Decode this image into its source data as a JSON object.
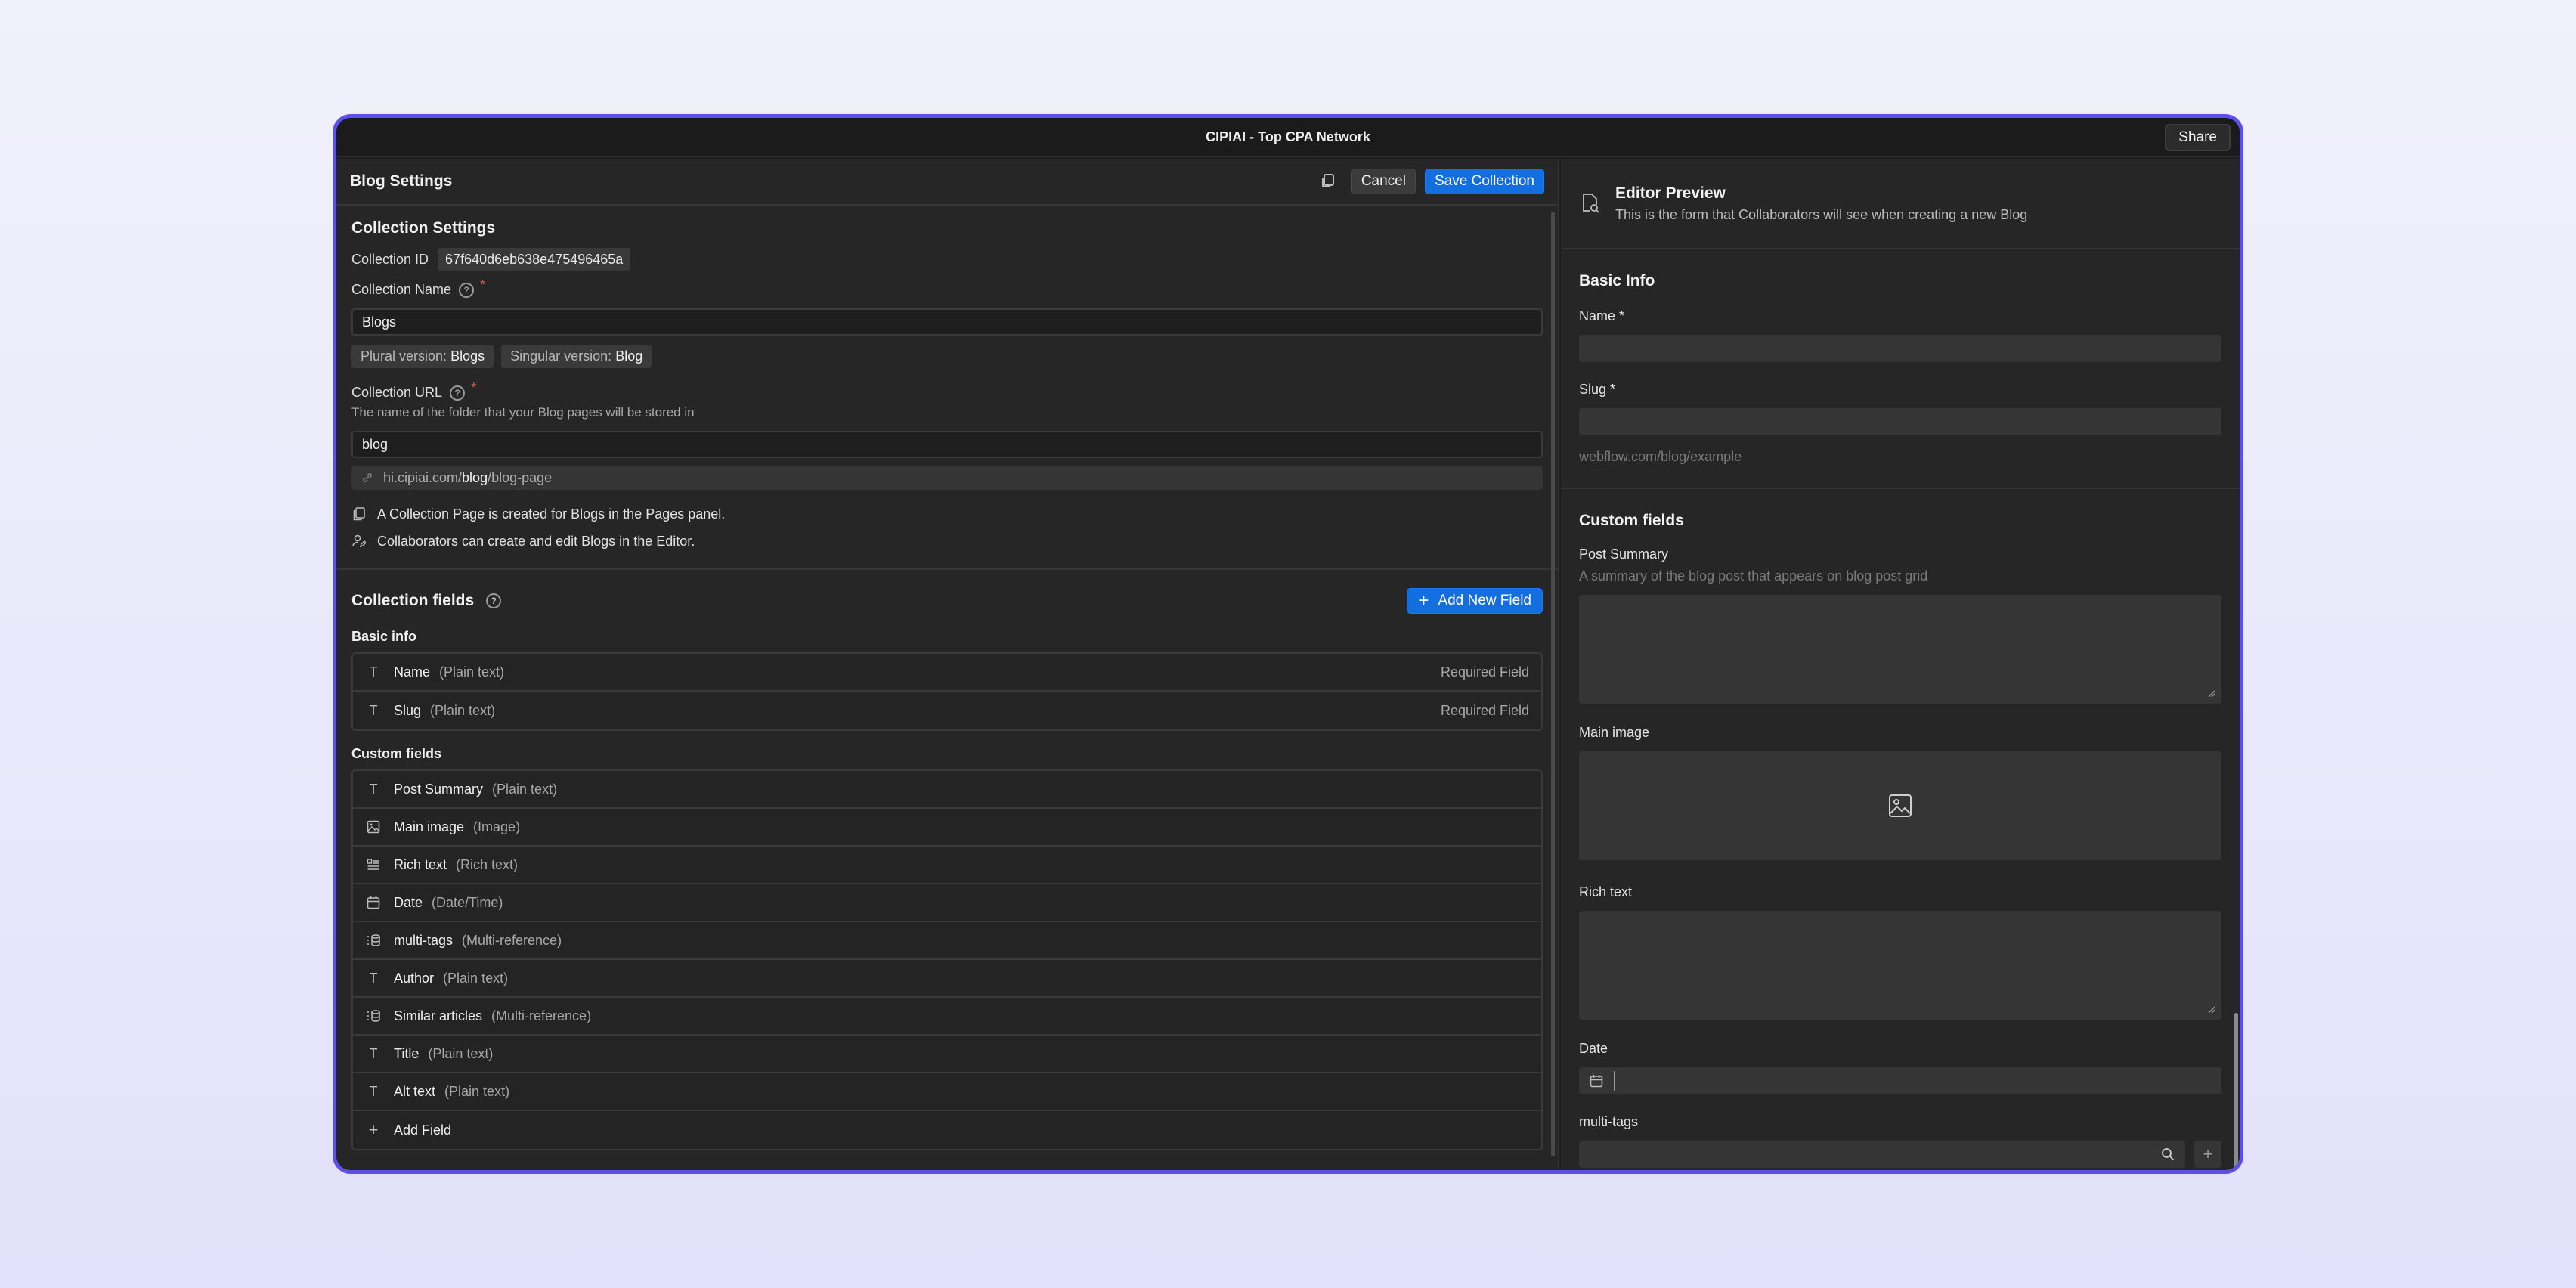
{
  "window": {
    "title": "CIPIAI - Top CPA Network",
    "share_label": "Share"
  },
  "left": {
    "header": {
      "title": "Blog Settings",
      "cancel_label": "Cancel",
      "save_label": "Save Collection"
    },
    "collection_settings": {
      "title": "Collection Settings",
      "id_label": "Collection ID",
      "id_value": "67f640d6eb638e475496465a",
      "name_label": "Collection Name",
      "name_value": "Blogs",
      "plural_label": "Plural version:",
      "plural_value": "Blogs",
      "singular_label": "Singular version:",
      "singular_value": "Blog",
      "url_label": "Collection URL",
      "url_hint": "The name of the folder that your Blog pages will be stored in",
      "url_value": "blog",
      "url_preview_pre": "hi.cipiai.com/",
      "url_preview_bold": "blog",
      "url_preview_post": "/blog-page",
      "info_pages": "A Collection Page is created for Blogs in the Pages panel.",
      "info_collab": "Collaborators can create and edit Blogs in the Editor."
    },
    "collection_fields": {
      "title": "Collection fields",
      "add_new_label": "Add New Field",
      "basic_label": "Basic info",
      "basic": [
        {
          "name": "Name",
          "type": "(Plain text)",
          "req": "Required Field"
        },
        {
          "name": "Slug",
          "type": "(Plain text)",
          "req": "Required Field"
        }
      ],
      "custom_label": "Custom fields",
      "custom": [
        {
          "name": "Post Summary",
          "type": "(Plain text)"
        },
        {
          "name": "Main image",
          "type": "(Image)"
        },
        {
          "name": "Rich text",
          "type": "(Rich text)"
        },
        {
          "name": "Date",
          "type": "(Date/Time)"
        },
        {
          "name": "multi-tags",
          "type": "(Multi-reference)"
        },
        {
          "name": "Author",
          "type": "(Plain text)"
        },
        {
          "name": "Similar articles",
          "type": "(Multi-reference)"
        },
        {
          "name": "Title",
          "type": "(Plain text)"
        },
        {
          "name": "Alt text",
          "type": "(Plain text)"
        }
      ],
      "add_field_label": "Add Field"
    }
  },
  "right": {
    "title": "Editor Preview",
    "subtitle": "This is the form that Collaborators will see when creating a new Blog",
    "basic_title": "Basic Info",
    "name_label": "Name *",
    "slug_label": "Slug *",
    "slug_hint": "webflow.com/blog/example",
    "custom_title": "Custom fields",
    "post_summary_label": "Post Summary",
    "post_summary_hint": "A summary of the blog post that appears on blog post grid",
    "main_image_label": "Main image",
    "rich_text_label": "Rich text",
    "date_label": "Date",
    "multi_tags_label": "multi-tags"
  },
  "colors": {
    "accent": "#136ee0",
    "frame": "#5b50e8",
    "required": "#e05a5a"
  }
}
